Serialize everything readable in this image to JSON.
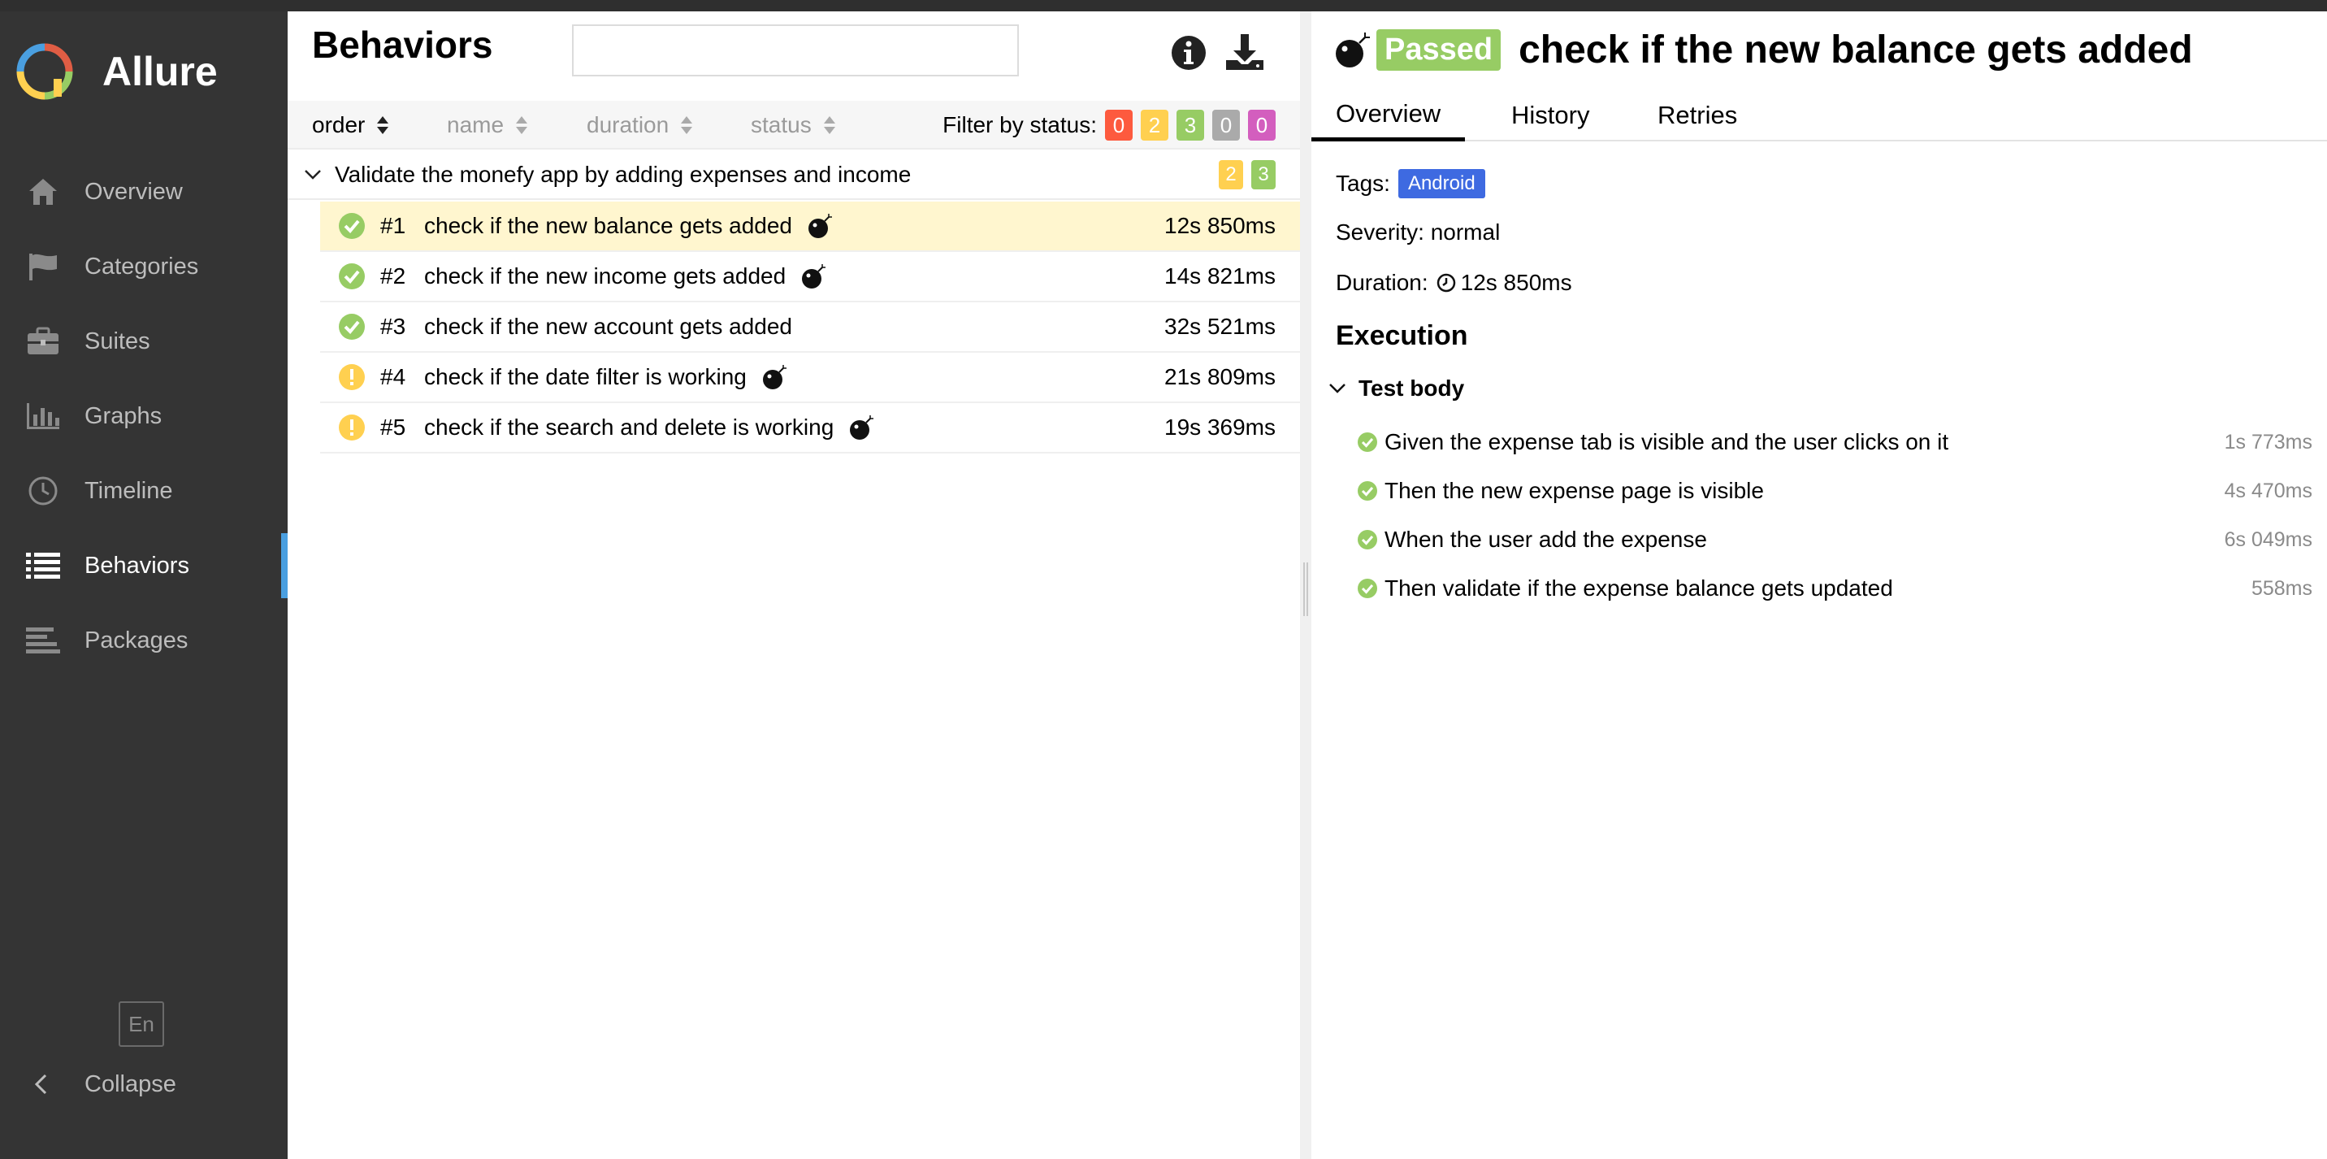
{
  "app": {
    "name": "Allure"
  },
  "sidebar": {
    "items": [
      {
        "label": "Overview",
        "icon": "home-icon"
      },
      {
        "label": "Categories",
        "icon": "flag-icon"
      },
      {
        "label": "Suites",
        "icon": "briefcase-icon"
      },
      {
        "label": "Graphs",
        "icon": "bar-chart-icon"
      },
      {
        "label": "Timeline",
        "icon": "clock-icon"
      },
      {
        "label": "Behaviors",
        "icon": "list-icon",
        "active": true
      },
      {
        "label": "Packages",
        "icon": "align-left-icon"
      }
    ],
    "language": "En",
    "collapse_label": "Collapse"
  },
  "behaviors": {
    "title": "Behaviors",
    "search": {
      "value": "",
      "placeholder": ""
    },
    "sort_columns": [
      "order",
      "name",
      "duration",
      "status"
    ],
    "filter_label": "Filter by status:",
    "status_counts": [
      {
        "value": "0",
        "color": "#fd5a3e"
      },
      {
        "value": "2",
        "color": "#ffd050"
      },
      {
        "value": "3",
        "color": "#97cc64"
      },
      {
        "value": "0",
        "color": "#aaaaaa"
      },
      {
        "value": "0",
        "color": "#d35ebe"
      }
    ],
    "group": {
      "name": "Validate the monefy app by adding expenses and income",
      "counts": [
        {
          "value": "2",
          "color": "#ffd050"
        },
        {
          "value": "3",
          "color": "#97cc64"
        }
      ]
    },
    "tests": [
      {
        "num": "#1",
        "name": "check if the new balance gets added",
        "duration": "12s 850ms",
        "status": "passed",
        "flaky": true,
        "selected": true
      },
      {
        "num": "#2",
        "name": "check if the new income gets added",
        "duration": "14s 821ms",
        "status": "passed",
        "flaky": true
      },
      {
        "num": "#3",
        "name": "check if the new account gets added",
        "duration": "32s 521ms",
        "status": "passed",
        "flaky": false
      },
      {
        "num": "#4",
        "name": "check if the date filter is working",
        "duration": "21s 809ms",
        "status": "broken",
        "flaky": true
      },
      {
        "num": "#5",
        "name": "check if the search and delete is working",
        "duration": "19s 369ms",
        "status": "broken",
        "flaky": true
      }
    ]
  },
  "detail": {
    "status": "Passed",
    "title": "check if the new balance gets added",
    "tabs": [
      "Overview",
      "History",
      "Retries"
    ],
    "tags_label": "Tags:",
    "tag": "Android",
    "severity": "Severity: normal",
    "duration_label": "Duration:",
    "duration": "12s 850ms",
    "execution_title": "Execution",
    "body_title": "Test body",
    "steps": [
      {
        "name": "Given the expense tab is visible and the user clicks on it",
        "duration": "1s 773ms"
      },
      {
        "name": "Then the new expense page is visible",
        "duration": "4s 470ms"
      },
      {
        "name": "When the user add the expense",
        "duration": "6s 049ms"
      },
      {
        "name": "Then validate if the expense balance gets updated",
        "duration": "558ms"
      }
    ]
  },
  "colors": {
    "sidebar_bg": "#343434",
    "active_accent": "#4a9fe0",
    "passed": "#97cc64",
    "broken": "#ffd050",
    "tag": "#3e6ae1",
    "selected_row": "#fff6cf"
  }
}
